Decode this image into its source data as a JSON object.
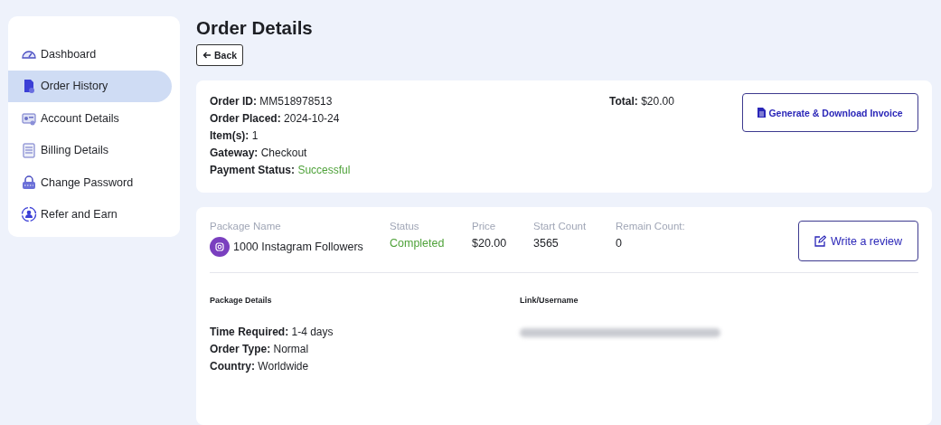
{
  "sidebar": {
    "items": [
      {
        "label": "Dashboard",
        "selected": false
      },
      {
        "label": "Order History",
        "selected": true
      },
      {
        "label": "Account Details",
        "selected": false
      },
      {
        "label": "Billing Details",
        "selected": false
      },
      {
        "label": "Change Password",
        "selected": false
      },
      {
        "label": "Refer and Earn",
        "selected": false
      }
    ]
  },
  "page": {
    "title": "Order Details",
    "back_button": "Back"
  },
  "order": {
    "fields": [
      {
        "label": "Order ID:",
        "value": "MM518978513",
        "kind": "plain"
      },
      {
        "label": "Order Placed:",
        "value": "2024-10-24",
        "kind": "plain"
      },
      {
        "label": "Item(s):",
        "value": "1",
        "kind": "plain"
      },
      {
        "label": "Gateway:",
        "value": "Checkout",
        "kind": "plain"
      },
      {
        "label": "Payment Status:",
        "value": "Successful",
        "kind": "status"
      }
    ],
    "total": {
      "label": "Total:",
      "value": "$20.00"
    },
    "invoice_button": "Generate & Download Invoice"
  },
  "package": {
    "columns": [
      {
        "heading": "Package Name",
        "value": "1000 Instagram Followers",
        "kind": "product"
      },
      {
        "heading": "Status",
        "value": "Completed",
        "kind": "status"
      },
      {
        "heading": "Price",
        "value": "$20.00",
        "kind": "plain"
      },
      {
        "heading": "Start Count",
        "value": "3565",
        "kind": "plain"
      },
      {
        "heading": "Remain Count:",
        "value": "0",
        "kind": "plain"
      }
    ],
    "review_button": "Write a review",
    "details_heading": "Package Details",
    "details": [
      {
        "label": "Time Required:",
        "value": "1-4 days"
      },
      {
        "label": "Order Type:",
        "value": "Normal"
      },
      {
        "label": "Country:",
        "value": "Worldwide"
      }
    ],
    "link_heading": "Link/Username",
    "link": {
      "redacted": true
    }
  }
}
